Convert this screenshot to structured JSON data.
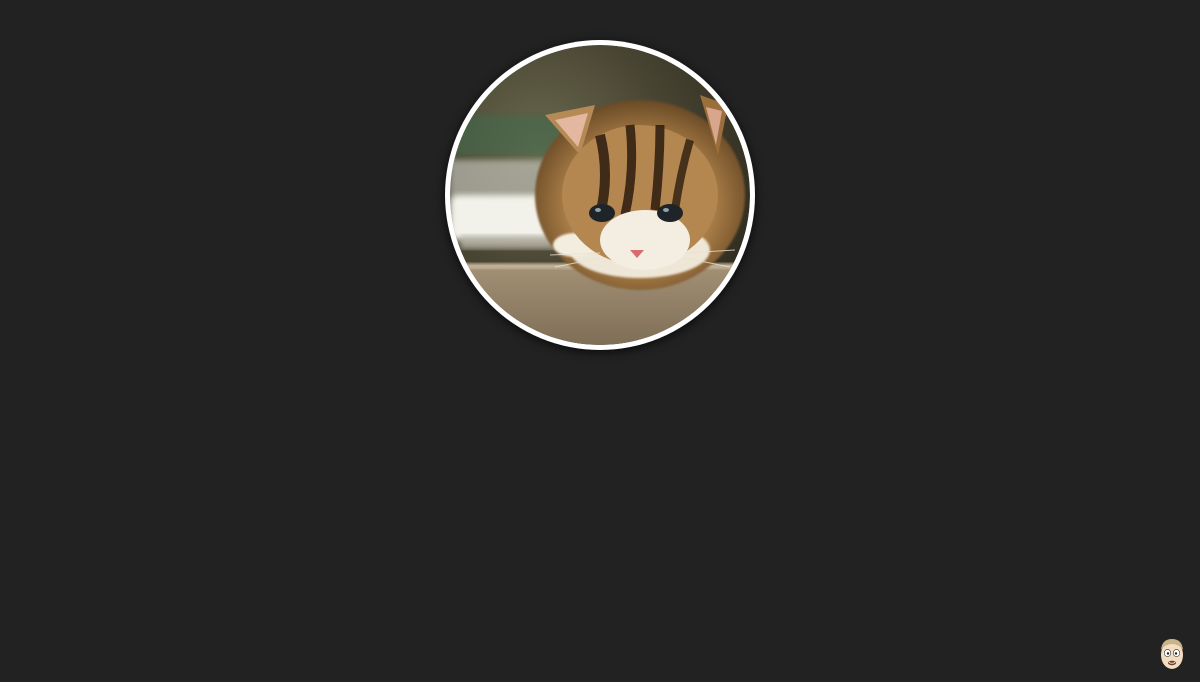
{
  "page": {
    "background_color": "#222222"
  },
  "profile_photo": {
    "subject": "tabby kitten",
    "frame_color": "#ffffff",
    "shape": "circle"
  },
  "corner_badge": {
    "icon": "cartoon-face-icon"
  }
}
